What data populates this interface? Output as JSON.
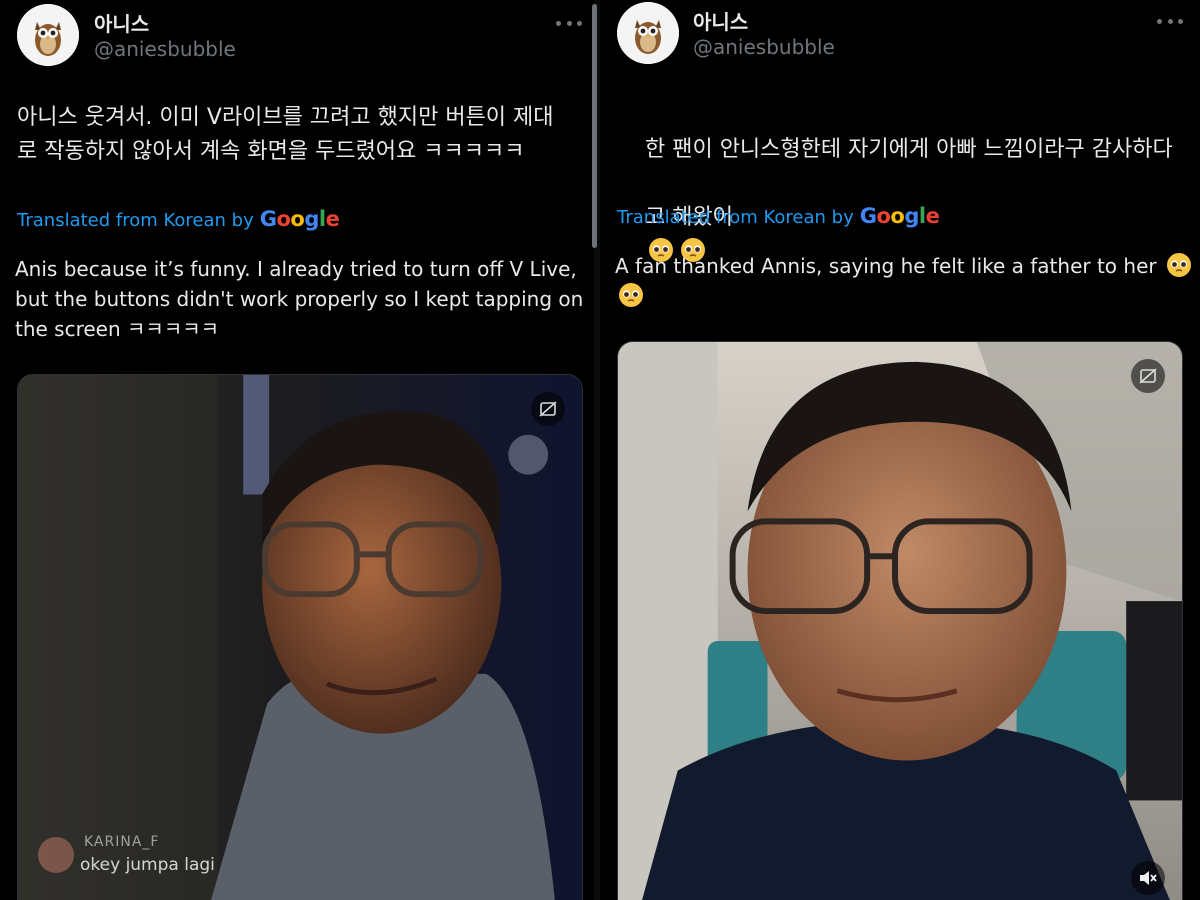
{
  "left_tweet": {
    "display_name": "아니스",
    "handle": "@aniesbubble",
    "avatar_icon": "owl-emoji",
    "text": "아니스 웃겨서. 이미 V라이브를 끄려고 했지만 버튼이 제대\n로 작동하지 않아서 계속 화면을 두드렸어요 ㅋㅋㅋㅋㅋ",
    "translated_label": "Translated from Korean by",
    "google_letters": [
      "G",
      "o",
      "o",
      "g",
      "l",
      "e"
    ],
    "translation": "Anis because it’s funny. I already tried to turn off V Live, but the buttons didn't work properly so I kept tapping on the screen ㅋㅋㅋㅋㅋ",
    "media": {
      "caption_name": "KARINA_F",
      "caption_text": "okey jumpa lagi",
      "caption_icon": "viewer-avatar-icon"
    }
  },
  "right_tweet": {
    "display_name": "아니스",
    "handle": "@aniesbubble",
    "avatar_icon": "owl-emoji",
    "text_line1": "한 팬이 안니스형한테 자기에게 아빠 느낌이라구 감사하다",
    "text_line2": "고 해왔어",
    "translated_label": "Translated from Korean by",
    "google_letters": [
      "G",
      "o",
      "o",
      "g",
      "l",
      "e"
    ],
    "translation": "A fan thanked Annis, saying he felt like a father to her",
    "emoji_icon": "pleading-face-emoji"
  },
  "colors": {
    "background": "#000000",
    "text": "#e7e9ea",
    "secondary": "#71767b",
    "link": "#1d9bf0",
    "google": [
      "#4285F4",
      "#EA4335",
      "#FBBC05",
      "#4285F4",
      "#34A853",
      "#EA4335"
    ]
  }
}
